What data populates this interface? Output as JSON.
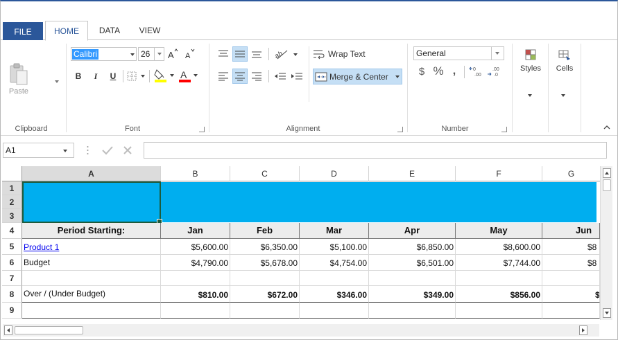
{
  "tabs": {
    "file": "FILE",
    "home": "HOME",
    "data": "DATA",
    "view": "VIEW"
  },
  "ribbon": {
    "clipboard": {
      "paste": "Paste",
      "group": "Clipboard"
    },
    "font": {
      "name": "Calibri",
      "size": "26",
      "bold": "B",
      "italic": "I",
      "underline": "U",
      "font_color_letter": "A",
      "group": "Font"
    },
    "alignment": {
      "wrap_text": "Wrap Text",
      "merge_center": "Merge & Center",
      "group": "Alignment"
    },
    "number": {
      "format": "General",
      "currency": "$",
      "percent": "%",
      "comma": ",",
      "group": "Number"
    },
    "styles": {
      "label": "Styles"
    },
    "cells": {
      "label": "Cells"
    }
  },
  "formula_bar": {
    "name_box": "A1",
    "formula": ""
  },
  "sheet": {
    "columns": [
      "A",
      "B",
      "C",
      "D",
      "E",
      "F",
      "G"
    ],
    "rows": [
      "1",
      "2",
      "3",
      "4",
      "5",
      "6",
      "7",
      "8",
      "9"
    ],
    "header_row": [
      "Period Starting:",
      "Jan",
      "Feb",
      "Mar",
      "Apr",
      "May",
      "Jun"
    ],
    "product_row": [
      "Product 1",
      "$5,600.00",
      "$6,350.00",
      "$5,100.00",
      "$6,850.00",
      "$8,600.00",
      "$8"
    ],
    "budget_row": [
      "Budget",
      "$4,790.00",
      "$5,678.00",
      "$4,754.00",
      "$6,501.00",
      "$7,744.00",
      "$8"
    ],
    "variance_row": [
      "Over / (Under Budget)",
      "$810.00",
      "$672.00",
      "$346.00",
      "$349.00",
      "$856.00",
      "$"
    ]
  },
  "colors": {
    "accent": "#2b579a",
    "banner": "#00aeef",
    "selection_border": "#1d5b3c",
    "highlight_yellow": "#ffff00",
    "font_red": "#ff0000",
    "link": "#0000ee"
  }
}
